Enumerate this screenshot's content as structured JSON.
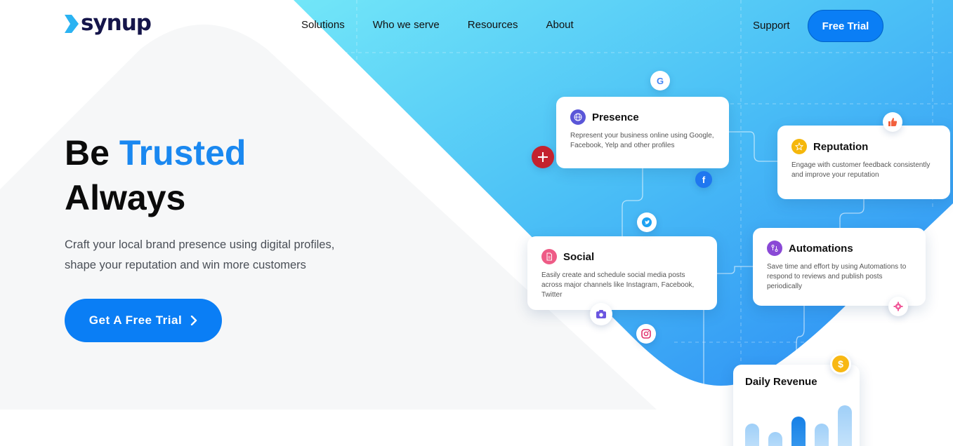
{
  "brand": {
    "name": "synup"
  },
  "nav": {
    "links": [
      "Solutions",
      "Who we serve",
      "Resources",
      "About"
    ],
    "support": "Support",
    "free_trial": "Free Trial"
  },
  "hero": {
    "title_be": "Be",
    "title_accent": "Trusted",
    "title_line2": "Always",
    "subtitle_line1": "Craft your local brand presence using digital profiles,",
    "subtitle_line2": "shape your reputation and win more customers",
    "cta_label": "Get A Free Trial"
  },
  "cards": {
    "presence": {
      "title": "Presence",
      "text": "Represent your business online using Google, Facebook, Yelp and other profiles"
    },
    "reputation": {
      "title": "Reputation",
      "text": "Engage with customer feedback consistently and improve your reputation"
    },
    "social": {
      "title": "Social",
      "text": "Easily create and schedule social media posts across major channels like Instagram, Facebook, Twitter"
    },
    "automations": {
      "title": "Automations",
      "text": "Save time and effort by using Automations to respond to reviews and publish posts periodically"
    },
    "revenue": {
      "title": "Daily Revenue"
    }
  },
  "bubbles": {
    "google": "G",
    "facebook": "f",
    "dollar": "$"
  },
  "colors": {
    "primary": "#0a7ef5",
    "accent_text": "#1a88f0",
    "brand_dark": "#15154a",
    "gradient_start": "#6ee6f7",
    "gradient_end": "#2f8ff5"
  }
}
